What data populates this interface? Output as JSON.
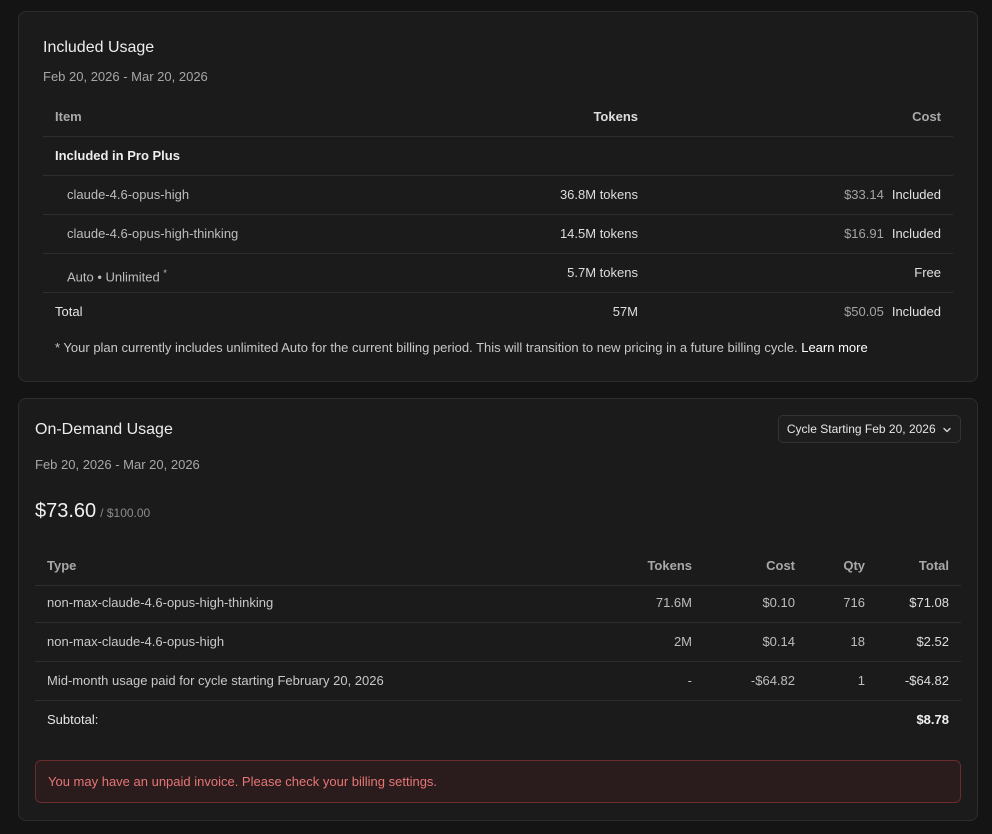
{
  "included": {
    "title": "Included Usage",
    "date_range": "Feb 20, 2026 - Mar 20, 2026",
    "columns": {
      "item": "Item",
      "tokens": "Tokens",
      "cost": "Cost"
    },
    "group_label": "Included in Pro Plus",
    "rows": [
      {
        "item": "claude-4.6-opus-high",
        "tokens": "36.8M tokens",
        "amount": "$33.14",
        "status": "Included"
      },
      {
        "item": "claude-4.6-opus-high-thinking",
        "tokens": "14.5M tokens",
        "amount": "$16.91",
        "status": "Included"
      },
      {
        "item": "Auto • Unlimited",
        "sup": "*",
        "tokens": "5.7M tokens",
        "amount": "",
        "status": "Free"
      }
    ],
    "total": {
      "label": "Total",
      "tokens": "57M",
      "amount": "$50.05",
      "status": "Included"
    },
    "footnote": "* Your plan currently includes unlimited Auto for the current billing period. This will transition to new pricing in a future billing cycle.",
    "learn_more": "Learn more"
  },
  "ondemand": {
    "title": "On-Demand Usage",
    "cycle_select": "Cycle Starting Feb 20, 2026",
    "date_range": "Feb 20, 2026 - Mar 20, 2026",
    "spent": "$73.60",
    "limit": "/ $100.00",
    "columns": {
      "type": "Type",
      "tokens": "Tokens",
      "cost": "Cost",
      "qty": "Qty",
      "total": "Total"
    },
    "rows": [
      {
        "type": "non-max-claude-4.6-opus-high-thinking",
        "tokens": "71.6M",
        "cost": "$0.10",
        "qty": "716",
        "total": "$71.08"
      },
      {
        "type": "non-max-claude-4.6-opus-high",
        "tokens": "2M",
        "cost": "$0.14",
        "qty": "18",
        "total": "$2.52"
      },
      {
        "type": "Mid-month usage paid for cycle starting February 20, 2026",
        "tokens": "-",
        "cost": "-$64.82",
        "qty": "1",
        "total": "-$64.82"
      }
    ],
    "subtotal": {
      "label": "Subtotal:",
      "value": "$8.78"
    },
    "alert": "You may have an unpaid invoice. Please check your billing settings."
  },
  "icons": {
    "dropdown": "chevron-down-icon"
  },
  "colors": {
    "alert_text": "#e77676",
    "alert_border": "#6a2c2c",
    "background": "#141414",
    "card": "#1b1b1b"
  }
}
